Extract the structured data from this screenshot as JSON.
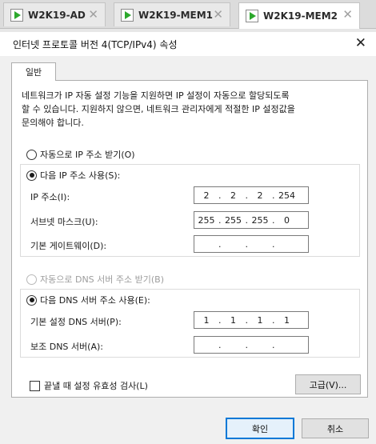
{
  "vm_tabs": [
    {
      "label": "W2K19-AD"
    },
    {
      "label": "W2K19-MEM1"
    },
    {
      "label": "W2K19-MEM2"
    }
  ],
  "dialog": {
    "title": "인터넷 프로토콜 버전 4(TCP/IPv4) 속성",
    "tab": "일반",
    "description_lines": [
      "네트워크가 IP 자동 설정 기능을 지원하면 IP 설정이 자동으로 할당되도록",
      "할 수 있습니다. 지원하지 않으면, 네트워크 관리자에게 적절한 IP 설정값을",
      "문의해야 합니다."
    ],
    "radio_auto_ip": "자동으로 IP 주소 받기(O)",
    "radio_manual_ip": "다음 IP 주소 사용(S):",
    "ip_label": "IP 주소(I):",
    "ip_value": [
      "2",
      "2",
      "2",
      "254"
    ],
    "subnet_label": "서브넷 마스크(U):",
    "subnet_value": [
      "255",
      "255",
      "255",
      "0"
    ],
    "gateway_label": "기본 게이트웨이(D):",
    "gateway_value": [
      "",
      "",
      "",
      ""
    ],
    "radio_auto_dns": "자동으로 DNS 서버 주소 받기(B)",
    "radio_manual_dns": "다음 DNS 서버 주소 사용(E):",
    "dns_pref_label": "기본 설정 DNS 서버(P):",
    "dns_pref_value": [
      "1",
      "1",
      "1",
      "1"
    ],
    "dns_alt_label": "보조 DNS 서버(A):",
    "dns_alt_value": [
      "",
      "",
      "",
      ""
    ],
    "validate_label": "끝낼 때 설정 유효성 검사(L)",
    "advanced_label": "고급(V)...",
    "ok_label": "확인",
    "cancel_label": "취소",
    "accent_color": "#0078d7"
  }
}
